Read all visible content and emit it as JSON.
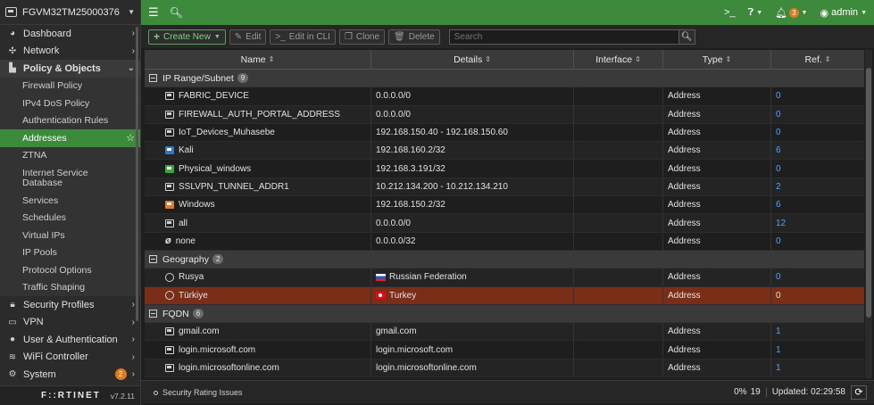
{
  "device": {
    "name": "FGVM32TM25000376"
  },
  "sidebar": {
    "items": [
      {
        "label": "Dashboard",
        "icon": "dashboard-icon"
      },
      {
        "label": "Network",
        "icon": "network-icon"
      },
      {
        "label": "Policy & Objects",
        "icon": "policy-icon"
      }
    ],
    "sub_items": [
      {
        "label": "Firewall Policy"
      },
      {
        "label": "IPv4 DoS Policy"
      },
      {
        "label": "Authentication Rules"
      },
      {
        "label": "Addresses"
      },
      {
        "label": "ZTNA"
      },
      {
        "label": "Internet Service Database"
      },
      {
        "label": "Services"
      },
      {
        "label": "Schedules"
      },
      {
        "label": "Virtual IPs"
      },
      {
        "label": "IP Pools"
      },
      {
        "label": "Protocol Options"
      },
      {
        "label": "Traffic Shaping"
      }
    ],
    "bottom_items": [
      {
        "label": "Security Profiles"
      },
      {
        "label": "VPN"
      },
      {
        "label": "User & Authentication"
      },
      {
        "label": "WiFi Controller"
      },
      {
        "label": "System",
        "badge": "2"
      }
    ],
    "logo": "F::RTINET",
    "version": "v7.2.11"
  },
  "topbar": {
    "alerts_count": "3",
    "user": "admin"
  },
  "toolbar": {
    "create_new": "Create New",
    "edit": "Edit",
    "edit_cli": "Edit in CLI",
    "clone": "Clone",
    "delete": "Delete",
    "search_placeholder": "Search"
  },
  "table": {
    "columns": [
      "Name",
      "Details",
      "Interface",
      "Type",
      "Ref."
    ],
    "groups": [
      {
        "label": "IP Range/Subnet",
        "count": "9",
        "rows": [
          {
            "icon": "address-icon",
            "name": "FABRIC_DEVICE",
            "details": "0.0.0.0/0",
            "interface": "",
            "type": "Address",
            "ref": "0"
          },
          {
            "icon": "address-icon",
            "name": "FIREWALL_AUTH_PORTAL_ADDRESS",
            "details": "0.0.0.0/0",
            "interface": "",
            "type": "Address",
            "ref": "0"
          },
          {
            "icon": "address-icon",
            "name": "IoT_Devices_Muhasebe",
            "details": "192.168.150.40 - 192.168.150.60",
            "interface": "",
            "type": "Address",
            "ref": "0"
          },
          {
            "icon": "address-blue-icon",
            "name": "Kali",
            "details": "192.168.160.2/32",
            "interface": "",
            "type": "Address",
            "ref": "6"
          },
          {
            "icon": "address-green-icon",
            "name": "Physical_windows",
            "details": "192.168.3.191/32",
            "interface": "",
            "type": "Address",
            "ref": "0"
          },
          {
            "icon": "address-icon",
            "name": "SSLVPN_TUNNEL_ADDR1",
            "details": "10.212.134.200 - 10.212.134.210",
            "interface": "",
            "type": "Address",
            "ref": "2"
          },
          {
            "icon": "address-orange-icon",
            "name": "Windows",
            "details": "192.168.150.2/32",
            "interface": "",
            "type": "Address",
            "ref": "6"
          },
          {
            "icon": "address-icon",
            "name": "all",
            "details": "0.0.0.0/0",
            "interface": "",
            "type": "Address",
            "ref": "12"
          },
          {
            "icon": "none-icon",
            "name": "none",
            "details": "0.0.0.0/32",
            "interface": "",
            "type": "Address",
            "ref": "0"
          }
        ]
      },
      {
        "label": "Geography",
        "count": "2",
        "rows": [
          {
            "icon": "globe-icon",
            "flag": "ru",
            "name": "Rusya",
            "details": "Russian Federation",
            "interface": "",
            "type": "Address",
            "ref": "0"
          },
          {
            "icon": "globe-icon",
            "flag": "tr",
            "name": "Türkiye",
            "details": "Turkey",
            "interface": "",
            "type": "Address",
            "ref": "0",
            "selected": true
          }
        ]
      },
      {
        "label": "FQDN",
        "count": "6",
        "rows": [
          {
            "icon": "address-icon",
            "name": "gmail.com",
            "details": "gmail.com",
            "interface": "",
            "type": "Address",
            "ref": "1"
          },
          {
            "icon": "address-icon",
            "name": "login.microsoft.com",
            "details": "login.microsoft.com",
            "interface": "",
            "type": "Address",
            "ref": "1"
          },
          {
            "icon": "address-icon",
            "name": "login.microsoftonline.com",
            "details": "login.microsoftonline.com",
            "interface": "",
            "type": "Address",
            "ref": "1"
          }
        ]
      }
    ]
  },
  "statusbar": {
    "security_rating": "Security Rating Issues",
    "percent": "0%",
    "count": "19",
    "updated": "Updated: 02:29:58"
  },
  "colors": {
    "accent_green": "#3d8a3d",
    "selected_row": "#7a2e17",
    "ref_link": "#4da3ff",
    "badge_orange": "#e07a1f"
  }
}
